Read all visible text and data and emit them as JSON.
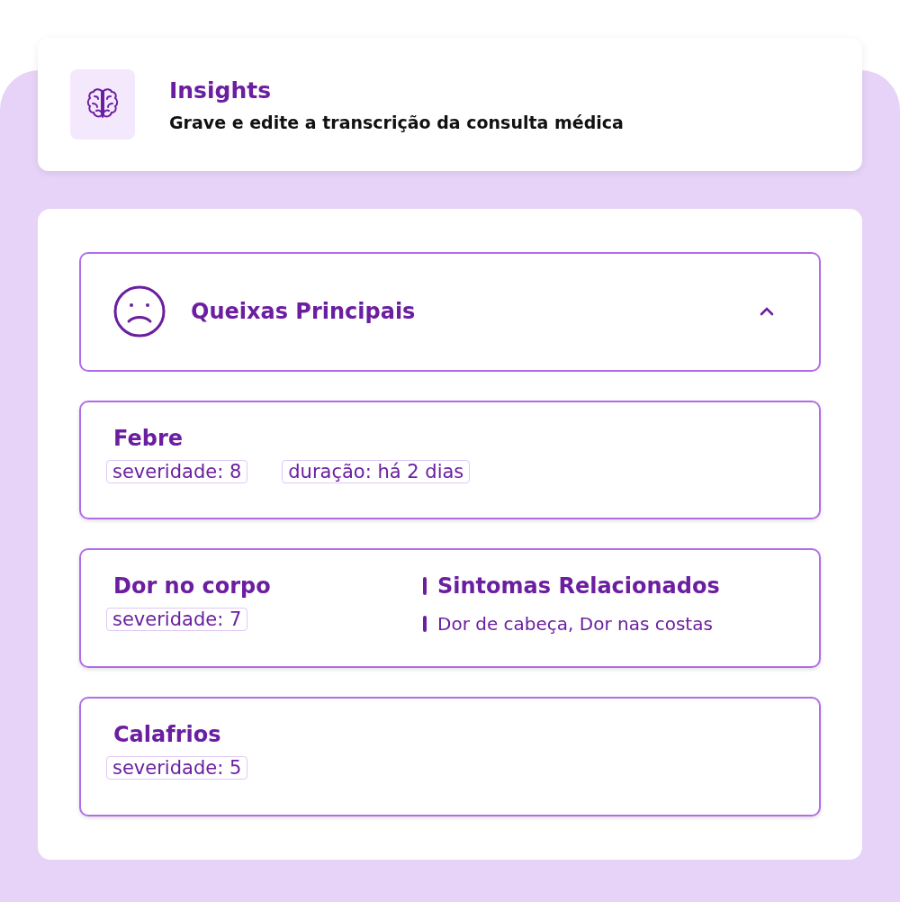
{
  "header": {
    "title": "Insights",
    "subtitle": "Grave e edite a transcrição da consulta médica"
  },
  "section": {
    "title": "Queixas Principais",
    "expanded": true
  },
  "complaints": [
    {
      "name": "Febre",
      "tags": [
        "severidade: 8",
        "duração: há 2 dias"
      ]
    },
    {
      "name": "Dor no corpo",
      "tags": [
        "severidade: 7"
      ],
      "related": {
        "title": "Sintomas Relacionados",
        "items": "Dor de cabeça, Dor nas costas"
      }
    },
    {
      "name": "Calafrios",
      "tags": [
        "severidade: 5"
      ]
    }
  ]
}
